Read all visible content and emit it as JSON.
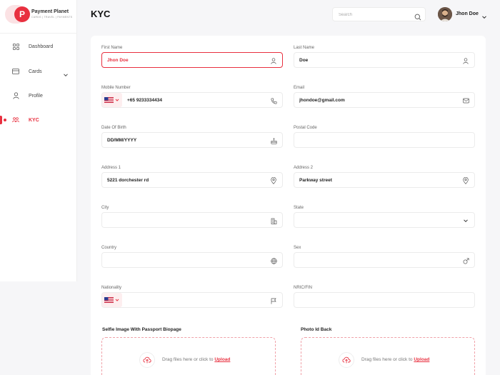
{
  "brand": {
    "name": "Payment Planet",
    "tagline": "CARDS | TRAVEL | PAYMENTS",
    "logo_letter": "P",
    "accent": "#e8303f"
  },
  "sidebar": {
    "items": [
      {
        "label": "Dashboard",
        "icon": "grid-icon"
      },
      {
        "label": "Cards",
        "icon": "card-icon",
        "has_submenu": true
      },
      {
        "label": "Profile",
        "icon": "user-icon"
      },
      {
        "label": "KYC",
        "icon": "kyc-icon",
        "active": true
      }
    ]
  },
  "header": {
    "title": "KYC",
    "search_placeholder": "Search",
    "user_name": "Jhon Doe"
  },
  "form": {
    "first_name": {
      "label": "First Name",
      "value": "Jhon Doe"
    },
    "last_name": {
      "label": "Last Name",
      "value": "Doe"
    },
    "mobile": {
      "label": "Mobile Number",
      "value": "+65 9233334434"
    },
    "email": {
      "label": "Email",
      "value": "jhondoe@gmail.com"
    },
    "dob": {
      "label": "Date Of Birth",
      "value": "DD/MM/YYYY"
    },
    "postal": {
      "label": "Postal Code",
      "value": ""
    },
    "address1": {
      "label": "Address 1",
      "value": "5221 dorchester rd"
    },
    "address2": {
      "label": "Address 2",
      "value": "Parkway street"
    },
    "city": {
      "label": "City",
      "value": ""
    },
    "state": {
      "label": "State",
      "value": ""
    },
    "country": {
      "label": "Country",
      "value": ""
    },
    "sex": {
      "label": "Sex",
      "value": ""
    },
    "nationality": {
      "label": "Nationality",
      "value": ""
    },
    "nric": {
      "label": "NRIC/FIN",
      "value": ""
    }
  },
  "uploads": {
    "selfie": {
      "title": "Selfie Image With Passport Biopage",
      "text": "Drag files here or click to",
      "link": "Upload"
    },
    "photo_id_back": {
      "title": "Photo Id Back",
      "text": "Drag files here or click to",
      "link": "Upload"
    }
  }
}
